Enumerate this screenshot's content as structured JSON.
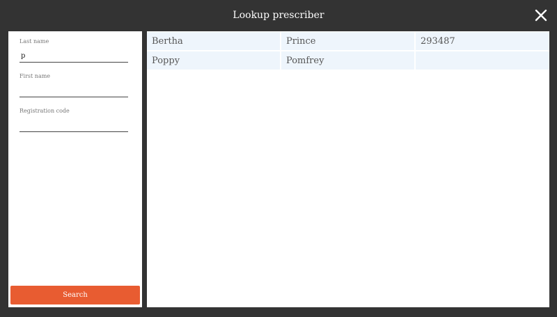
{
  "dialog": {
    "title": "Lookup prescriber",
    "close_icon": "close-icon"
  },
  "form": {
    "last_name": {
      "label": "Last name",
      "value": "p"
    },
    "first_name": {
      "label": "First name",
      "value": ""
    },
    "registration_code": {
      "label": "Registration code",
      "value": ""
    },
    "search_label": "Search"
  },
  "results": {
    "rows": [
      {
        "first_name": "Bertha",
        "last_name": "Prince",
        "code": "293487"
      },
      {
        "first_name": "Poppy",
        "last_name": "Pomfrey",
        "code": ""
      }
    ]
  },
  "colors": {
    "background": "#333333",
    "accent": "#e85c31",
    "row_highlight": "#eef5fc"
  }
}
